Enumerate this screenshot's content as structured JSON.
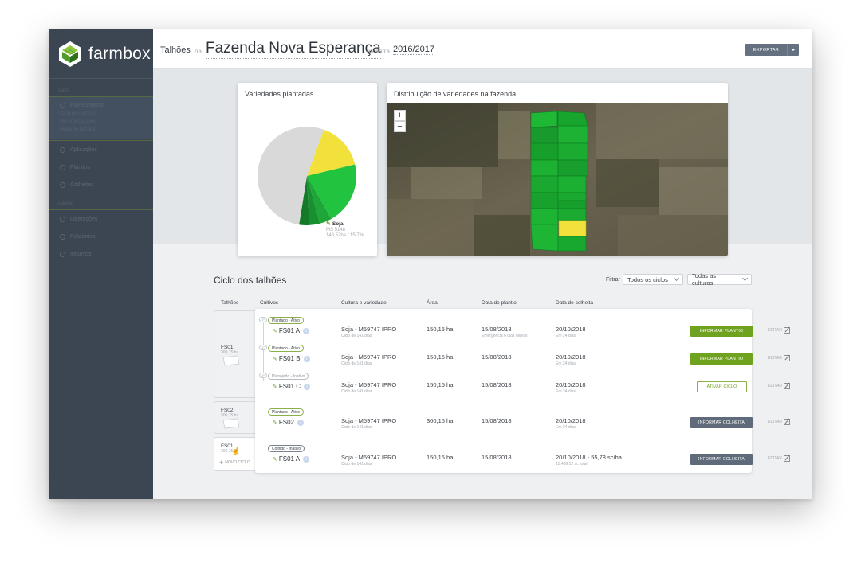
{
  "app": {
    "logo_text": "farmbox"
  },
  "sidebar": {
    "section1": "Safra",
    "group_title": "Planejamento",
    "group_items": [
      "Ciclo dos talhões",
      "Recomendações",
      "Mapa de talhões"
    ],
    "items1": [
      "Aplicações",
      "Plantios",
      "Colheitas"
    ],
    "section2": "Gestão",
    "items2": [
      "Operações",
      "Relatórios",
      "Insumos"
    ]
  },
  "header": {
    "title": "Talhões",
    "na": "na",
    "farm": "Fazenda Nova Esperança",
    "na_safra": "na safra",
    "season": "2016/2017",
    "export_label": "EXPORTAR"
  },
  "pie_card": {
    "title": "Variedades plantadas",
    "label_culture": "Soja",
    "label_variety": "MS 5148",
    "label_area": "148,52ha / 15,7%"
  },
  "chart_data": {
    "type": "pie",
    "slices": [
      {
        "label": "Soja MS 5148",
        "value": 15.7,
        "color": "#f2e13a"
      },
      {
        "label": "",
        "value": 20.5,
        "color": "#22c33f"
      },
      {
        "label": "",
        "value": 4.0,
        "color": "#1ea638"
      },
      {
        "label": "",
        "value": 3.5,
        "color": "#189030"
      },
      {
        "label": "",
        "value": 3.3,
        "color": "#137a28"
      },
      {
        "label": "",
        "value": 53.0,
        "color": "#d9d9d9"
      }
    ]
  },
  "map_card": {
    "title": "Distribuição de variedades na fazenda",
    "zoom_in": "+",
    "zoom_out": "−"
  },
  "ciclo": {
    "title": "Ciclo dos talhões",
    "filter_label": "Filtrar",
    "filter_cycles": "Todos os ciclos",
    "filter_cultures": "Todas as culturas",
    "headers": [
      "Talhões",
      "Cultivos",
      "Cultura e variedade",
      "Área",
      "Data de plantio",
      "Data de colheita"
    ],
    "fields": [
      {
        "name": "FS01",
        "area": "300,15 ha"
      },
      {
        "name": "FS02",
        "area": "300,15 ha"
      },
      {
        "name": "FS01",
        "area": "300,15 ha",
        "new_cycle": "NOVO CICLO"
      }
    ],
    "rows": [
      {
        "tree": "1º",
        "status": "Plantado - Ativo",
        "name": "FS01 A",
        "variety": "Soja - M59747 IPRO",
        "cycle": "Ciclo de 141 dias",
        "area": "150,15 ha",
        "planted": "15/08/2018",
        "planted_sub": "Emergência 6 dias depois",
        "harvest": "20/10/2018",
        "harvest_sub": "Em 24 dias",
        "action": "INFORMAR PLANTIO",
        "edit": "EDITAR"
      },
      {
        "tree": "1º",
        "status": "Plantado - Ativo",
        "name": "FS01 B",
        "variety": "Soja - M59747 IPRO",
        "cycle": "Ciclo de 141 dias",
        "area": "150,15 ha",
        "planted": "15/08/2018",
        "planted_sub": "",
        "harvest": "20/10/2018",
        "harvest_sub": "Em 24 dias",
        "action": "INFORMAR PLANTIO",
        "edit": "EDITAR"
      },
      {
        "tree": "2º",
        "status": "Planejado - Inativo",
        "name": "FS01 C",
        "variety": "Soja - M59747 IPRO",
        "cycle": "Ciclo de 141 dias",
        "area": "150,15 ha",
        "planted": "15/08/2018",
        "planted_sub": "",
        "harvest": "20/10/2018",
        "harvest_sub": "Em 24 dias",
        "action": "ATIVAR CICLO",
        "edit": "EDITAR"
      },
      {
        "tree": "",
        "status": "Plantado - Ativo",
        "name": "FS02",
        "variety": "Soja - M59747 IPRO",
        "cycle": "Ciclo de 141 dias",
        "area": "300,15 ha",
        "planted": "15/08/2018",
        "planted_sub": "",
        "harvest": "20/10/2018",
        "harvest_sub": "Em 24 dias",
        "action": "INFORMAR COLHEITA",
        "edit": "EDITAR"
      },
      {
        "tree": "",
        "status": "Colhido - Inativo",
        "name": "FS01 A",
        "variety": "Soja - M59747 IPRO",
        "cycle": "Ciclo de 141 dias",
        "area": "150,15 ha",
        "planted": "15/08/2018",
        "planted_sub": "",
        "harvest": "20/10/2018 - 55,78 sc/ha",
        "harvest_sub": "15.486,12 sc total",
        "action": "INFORMAR COLHEITA",
        "edit": "EDITAR"
      }
    ]
  }
}
